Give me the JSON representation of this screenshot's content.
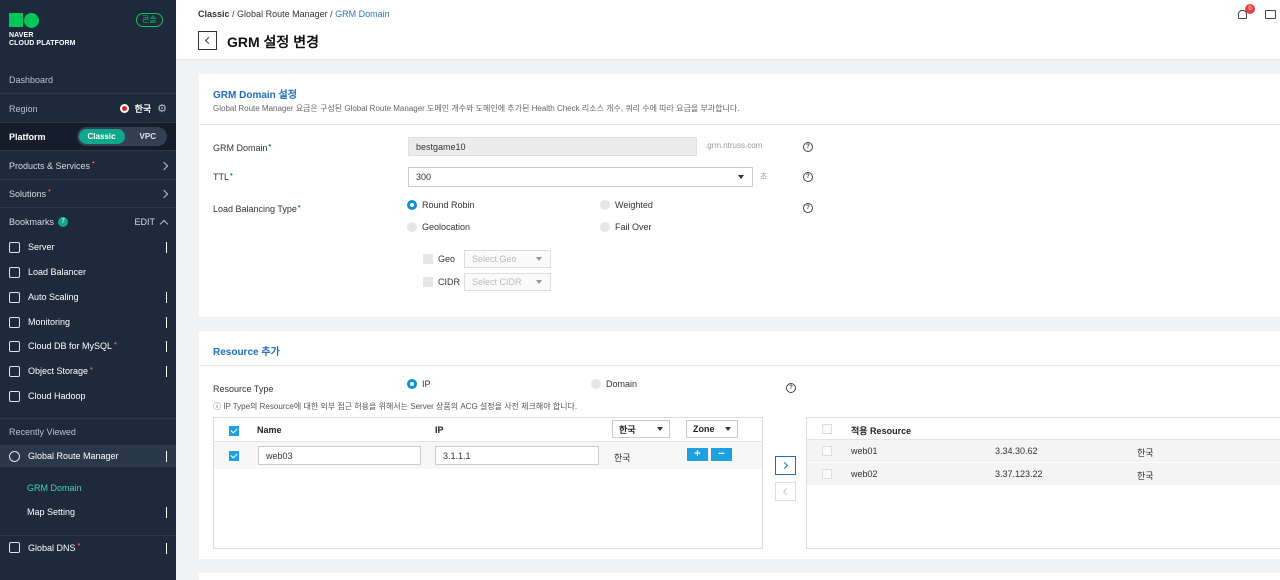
{
  "sidebar": {
    "brand_line1": "NAVER",
    "brand_line2": "CLOUD PLATFORM",
    "console_badge": "콘솔",
    "dashboard": "Dashboard",
    "region_label": "Region",
    "region_value": "한국",
    "platform_label": "Platform",
    "platform_options": [
      "Classic",
      "VPC"
    ],
    "products_services": "Products & Services",
    "solutions": "Solutions",
    "bookmarks_label": "Bookmarks",
    "bookmarks_count": "7",
    "bookmarks_edit": "EDIT",
    "bookmark_items": [
      {
        "label": "Server",
        "icon": "server-icon"
      },
      {
        "label": "Load Balancer",
        "icon": "load-balancer-icon"
      },
      {
        "label": "Auto Scaling",
        "icon": "auto-scaling-icon"
      },
      {
        "label": "Monitoring",
        "icon": "monitoring-icon"
      },
      {
        "label": "Cloud DB for MySQL",
        "icon": "database-icon"
      },
      {
        "label": "Object Storage",
        "icon": "storage-icon"
      },
      {
        "label": "Cloud Hadoop",
        "icon": "hadoop-icon"
      }
    ],
    "recently_viewed": "Recently Viewed",
    "grm_label": "Global Route Manager",
    "grm_sub": [
      "GRM Domain",
      "Map Setting"
    ],
    "global_dns": "Global DNS"
  },
  "header": {
    "breadcrumb": [
      "Classic",
      "Global Route Manager",
      "GRM Domain"
    ],
    "title": "GRM 설정 변경",
    "notification_count": "0"
  },
  "domain_card": {
    "title": "GRM Domain 설정",
    "description": "Global Route Manager 요금은 구성된 Global Route Manager 도메인 개수와 도메인에 추가된 Health Check 리소스 개수, 쿼리 수에 따라 요금을 부과합니다.",
    "grm_domain_label": "GRM Domain",
    "grm_domain_value": "bestgame10",
    "grm_domain_suffix": ".grm.ntruss.com",
    "ttl_label": "TTL",
    "ttl_value": "300",
    "ttl_unit": "초",
    "lb_type_label": "Load Balancing Type",
    "lb_options": [
      "Round Robin",
      "Weighted",
      "Geolocation",
      "Fail Over"
    ],
    "lb_selected": "Round Robin",
    "geo_label": "Geo",
    "geo_placeholder": "Select Geo",
    "cidr_label": "CIDR",
    "cidr_placeholder": "Select CIDR",
    "help_glyph": "?"
  },
  "resource_card": {
    "title": "Resource 추가",
    "resource_type_label": "Resource Type",
    "resource_type_options": [
      "IP",
      "Domain"
    ],
    "resource_type_selected": "IP",
    "info_text": "ⓘ IP Type의 Resource에 대한 외부 접근 허용을 위해서는 Server 상품의 ACG 설정을 사전 체크해야 합니다.",
    "left_table": {
      "headers": {
        "name": "Name",
        "ip": "IP",
        "region": "한국",
        "zone": "Zone"
      },
      "row": {
        "name": "web03",
        "ip": "3.1.1.1",
        "region": "한국"
      },
      "add": "+",
      "remove": "−"
    },
    "right_table": {
      "header": "적용 Resource",
      "rows": [
        {
          "name": "web01",
          "ip": "3.34.30.62",
          "region": "한국"
        },
        {
          "name": "web02",
          "ip": "3.37.123.22",
          "region": "한국"
        }
      ]
    }
  }
}
